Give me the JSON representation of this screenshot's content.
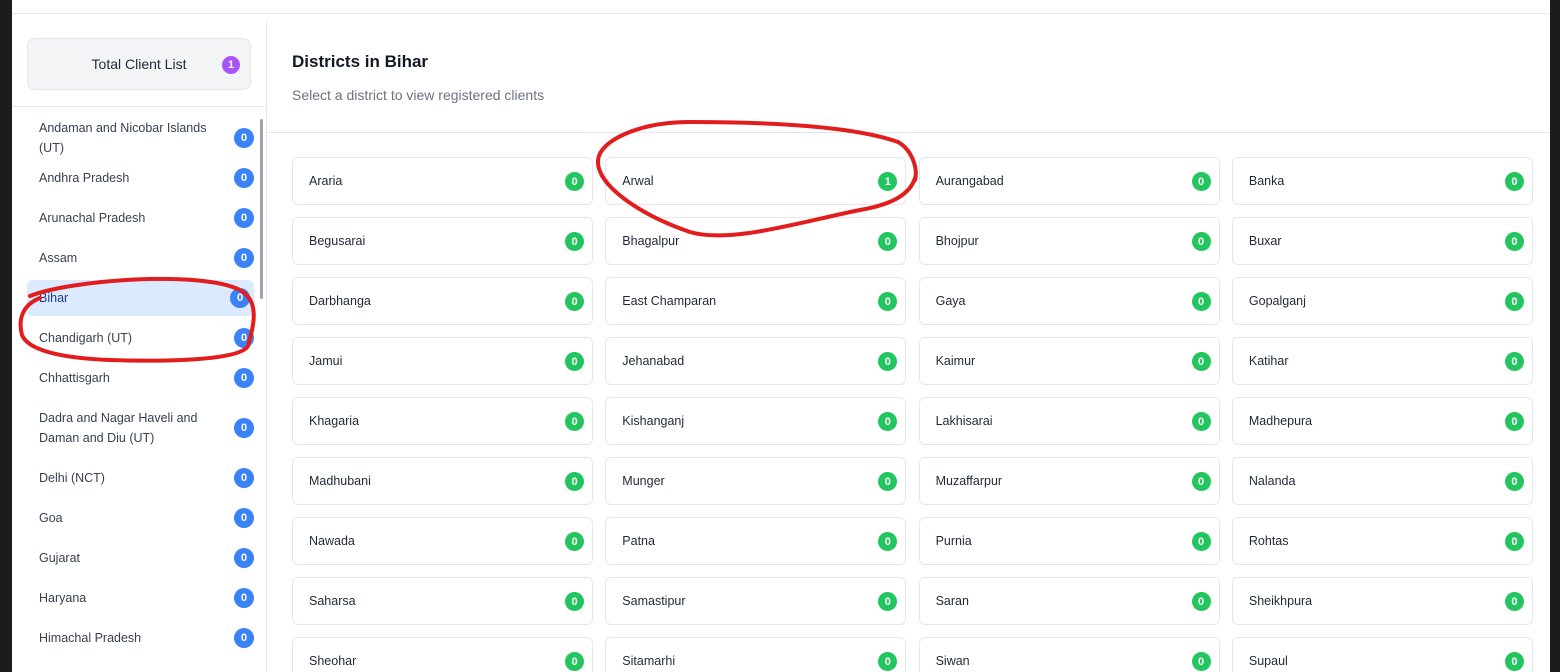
{
  "sidebar": {
    "total": {
      "label": "Total Client List",
      "count": "1"
    },
    "states": [
      {
        "name": "Andaman and Nicobar Islands (UT)",
        "count": "0"
      },
      {
        "name": "Andhra Pradesh",
        "count": "0"
      },
      {
        "name": "Arunachal Pradesh",
        "count": "0"
      },
      {
        "name": "Assam",
        "count": "0"
      },
      {
        "name": "Bihar",
        "count": "0"
      },
      {
        "name": "Chandigarh (UT)",
        "count": "0"
      },
      {
        "name": "Chhattisgarh",
        "count": "0"
      },
      {
        "name": "Dadra and Nagar Haveli and Daman and Diu (UT)",
        "count": "0"
      },
      {
        "name": "Delhi (NCT)",
        "count": "0"
      },
      {
        "name": "Goa",
        "count": "0"
      },
      {
        "name": "Gujarat",
        "count": "0"
      },
      {
        "name": "Haryana",
        "count": "0"
      },
      {
        "name": "Himachal Pradesh",
        "count": "0"
      }
    ]
  },
  "main": {
    "title": "Districts in Bihar",
    "subtitle": "Select a district to view registered clients",
    "districts": [
      {
        "name": "Araria",
        "count": "0"
      },
      {
        "name": "Arwal",
        "count": "1"
      },
      {
        "name": "Aurangabad",
        "count": "0"
      },
      {
        "name": "Banka",
        "count": "0"
      },
      {
        "name": "Begusarai",
        "count": "0"
      },
      {
        "name": "Bhagalpur",
        "count": "0"
      },
      {
        "name": "Bhojpur",
        "count": "0"
      },
      {
        "name": "Buxar",
        "count": "0"
      },
      {
        "name": "Darbhanga",
        "count": "0"
      },
      {
        "name": "East Champaran",
        "count": "0"
      },
      {
        "name": "Gaya",
        "count": "0"
      },
      {
        "name": "Gopalganj",
        "count": "0"
      },
      {
        "name": "Jamui",
        "count": "0"
      },
      {
        "name": "Jehanabad",
        "count": "0"
      },
      {
        "name": "Kaimur",
        "count": "0"
      },
      {
        "name": "Katihar",
        "count": "0"
      },
      {
        "name": "Khagaria",
        "count": "0"
      },
      {
        "name": "Kishanganj",
        "count": "0"
      },
      {
        "name": "Lakhisarai",
        "count": "0"
      },
      {
        "name": "Madhepura",
        "count": "0"
      },
      {
        "name": "Madhubani",
        "count": "0"
      },
      {
        "name": "Munger",
        "count": "0"
      },
      {
        "name": "Muzaffarpur",
        "count": "0"
      },
      {
        "name": "Nalanda",
        "count": "0"
      },
      {
        "name": "Nawada",
        "count": "0"
      },
      {
        "name": "Patna",
        "count": "0"
      },
      {
        "name": "Purnia",
        "count": "0"
      },
      {
        "name": "Rohtas",
        "count": "0"
      },
      {
        "name": "Saharsa",
        "count": "0"
      },
      {
        "name": "Samastipur",
        "count": "0"
      },
      {
        "name": "Saran",
        "count": "0"
      },
      {
        "name": "Sheikhpura",
        "count": "0"
      },
      {
        "name": "Sheohar",
        "count": "0"
      },
      {
        "name": "Sitamarhi",
        "count": "0"
      },
      {
        "name": "Siwan",
        "count": "0"
      },
      {
        "name": "Supaul",
        "count": "0"
      }
    ]
  },
  "colors": {
    "accent_purple": "#a855f7",
    "state_badge_blue": "#3b82f6",
    "district_badge_green": "#22c55e",
    "active_state_bg": "#dbeafe",
    "annotation_red": "#e11d1d"
  }
}
